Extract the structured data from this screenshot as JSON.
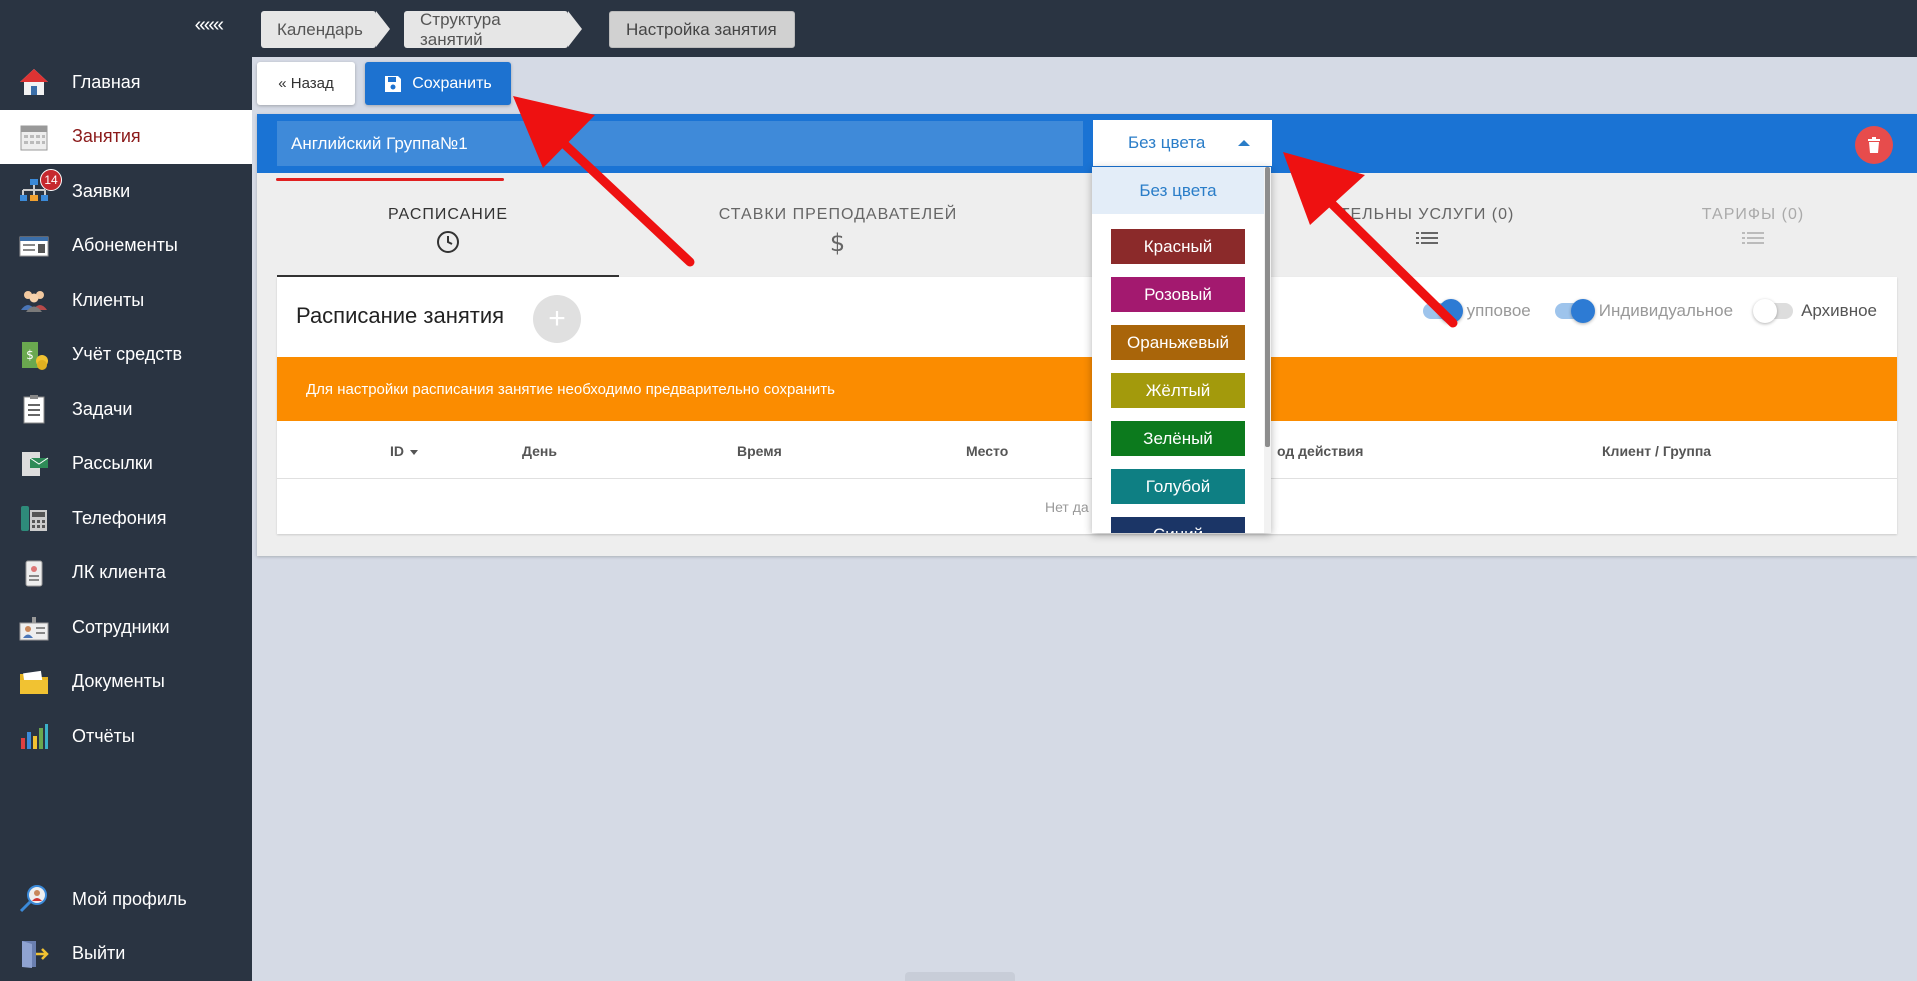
{
  "sidebar": {
    "collapse_label": "«««",
    "items": [
      {
        "label": "Главная",
        "icon": "home-icon"
      },
      {
        "label": "Занятия",
        "icon": "calendar-icon",
        "active": true
      },
      {
        "label": "Заявки",
        "icon": "requests-icon",
        "badge": "14"
      },
      {
        "label": "Абонементы",
        "icon": "subscription-card-icon"
      },
      {
        "label": "Клиенты",
        "icon": "clients-icon"
      },
      {
        "label": "Учёт средств",
        "icon": "money-icon"
      },
      {
        "label": "Задачи",
        "icon": "tasks-clipboard-icon"
      },
      {
        "label": "Рассылки",
        "icon": "mailing-icon"
      },
      {
        "label": "Телефония",
        "icon": "phone-icon"
      },
      {
        "label": "ЛК клиента",
        "icon": "client-cabinet-icon"
      },
      {
        "label": "Сотрудники",
        "icon": "staff-icon"
      },
      {
        "label": "Документы",
        "icon": "folder-icon"
      },
      {
        "label": "Отчёты",
        "icon": "reports-chart-icon"
      }
    ],
    "bottom_items": [
      {
        "label": "Мой профиль",
        "icon": "profile-search-icon"
      },
      {
        "label": "Выйти",
        "icon": "logout-door-icon"
      }
    ]
  },
  "breadcrumbs": [
    "Календарь",
    "Структура занятий",
    "Настройка занятия"
  ],
  "toolbar": {
    "back_label": "« Назад",
    "save_label": "Сохранить"
  },
  "lesson": {
    "name": "Английский Группа№1",
    "color_selected": "Без цвета"
  },
  "tabs": [
    {
      "label": "РАСПИСАНИЕ",
      "icon": "clock-icon"
    },
    {
      "label": "СТАВКИ ПРЕПОДАВАТЕЛЕЙ",
      "icon": "dollar-icon"
    },
    {
      "label": "ТЕЛЬНЫ УСЛУГИ (0)",
      "icon": "list-icon"
    },
    {
      "label": "ТАРИФЫ (0)",
      "icon": "list-icon"
    }
  ],
  "schedule": {
    "title": "Расписание занятия",
    "add_symbol": "+",
    "toggles": [
      {
        "label": "упповое",
        "on": true
      },
      {
        "label": "Индивидуальное",
        "on": true
      },
      {
        "label": "Архивное",
        "on": false
      }
    ],
    "alert": "Для настройки расписания занятие необходимо предварительно сохранить",
    "columns": [
      "ID",
      "День",
      "Время",
      "Место",
      "од действия",
      "Клиент / Группа"
    ],
    "empty_text": "Нет да"
  },
  "color_dropdown": {
    "options": [
      {
        "label": "Без цвета",
        "color": ""
      },
      {
        "label": "Красный",
        "color": "#8b2a2a"
      },
      {
        "label": "Розовый",
        "color": "#a3196f"
      },
      {
        "label": "Ораньжевый",
        "color": "#a9650a"
      },
      {
        "label": "Жёлтый",
        "color": "#a39a0c"
      },
      {
        "label": "Зелёный",
        "color": "#0c7a1d"
      },
      {
        "label": "Голубой",
        "color": "#0e7f83"
      },
      {
        "label": "Синий",
        "color": "#1b3566"
      }
    ]
  },
  "colors": {
    "sidebar_bg": "#2a3442",
    "accent_blue": "#1a73d4",
    "alert_orange": "#fb8c00",
    "active_text": "#8b1a1a",
    "annotation_red": "#ee1111"
  }
}
